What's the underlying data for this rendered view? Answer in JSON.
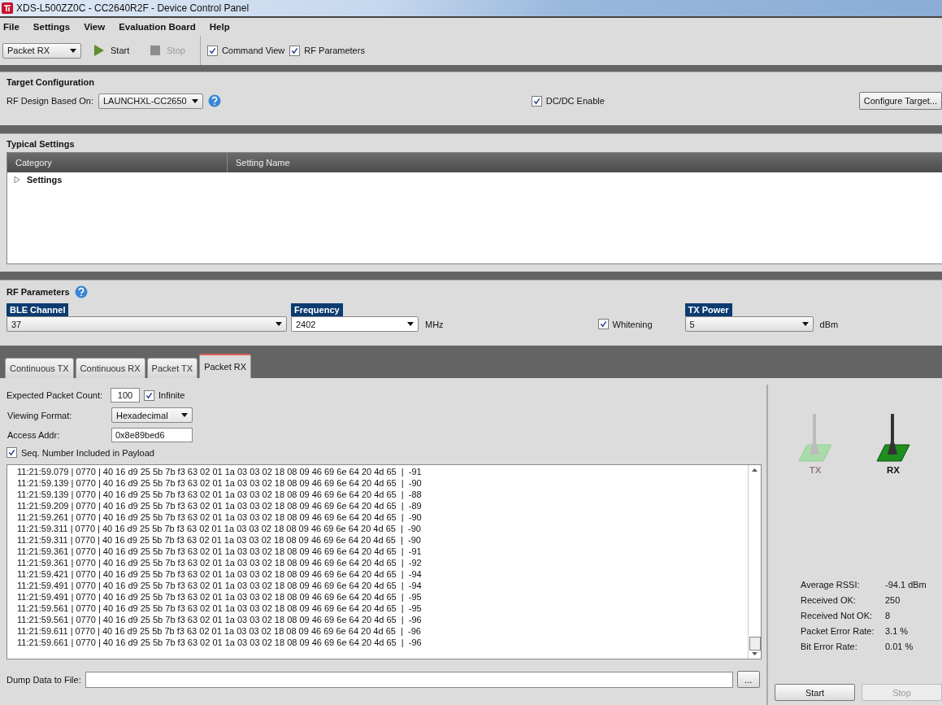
{
  "window": {
    "title": "XDS-L500ZZ0C - CC2640R2F - Device Control Panel"
  },
  "menu": [
    "File",
    "Settings",
    "View",
    "Evaluation Board",
    "Help"
  ],
  "toolbar": {
    "mode": "Packet RX",
    "start": {
      "label": "Start",
      "disabled": false
    },
    "stop": {
      "label": "Stop",
      "disabled": true
    },
    "checks": [
      {
        "label": "Command View",
        "checked": true
      },
      {
        "label": "RF Parameters",
        "checked": true
      }
    ]
  },
  "target": {
    "title": "Target Configuration",
    "design_label": "RF Design Based On:",
    "design": "LAUNCHXL-CC2650",
    "dcdc": {
      "label": "DC/DC Enable",
      "checked": true
    },
    "configure": "Configure Target..."
  },
  "typical": {
    "title": "Typical Settings",
    "columns": [
      "Category",
      "Setting Name"
    ],
    "rows": [
      {
        "label": "Settings",
        "expanded": false
      }
    ]
  },
  "rf": {
    "title": "RF Parameters",
    "channel": {
      "label": "BLE Channel",
      "value": "37"
    },
    "frequency": {
      "label": "Frequency",
      "value": "2402",
      "unit": "MHz"
    },
    "whitening": {
      "label": "Whitening",
      "checked": true
    },
    "power": {
      "label": "TX Power",
      "value": "5",
      "unit": "dBm"
    }
  },
  "tabs": [
    {
      "label": "Continuous TX",
      "selected": false
    },
    {
      "label": "Continuous RX",
      "selected": false
    },
    {
      "label": "Packet TX",
      "selected": false
    },
    {
      "label": "Packet RX",
      "selected": true
    }
  ],
  "packet_rx": {
    "count_label": "Expected Packet Count:",
    "count": "100",
    "infinite": {
      "label": "Infinite",
      "checked": true
    },
    "format_label": "Viewing Format:",
    "format": "Hexadecimal",
    "addr_label": "Access Addr:",
    "addr": "0x8e89bed6",
    "seq": {
      "label": "Seq. Number Included in Payload",
      "checked": true
    },
    "log": [
      "11:21:59.079 | 0770 | 40 16 d9 25 5b 7b f3 63 02 01 1a 03 03 02 18 08 09 46 69 6e 64 20 4d 65  |  -91",
      "11:21:59.139 | 0770 | 40 16 d9 25 5b 7b f3 63 02 01 1a 03 03 02 18 08 09 46 69 6e 64 20 4d 65  |  -90",
      "11:21:59.139 | 0770 | 40 16 d9 25 5b 7b f3 63 02 01 1a 03 03 02 18 08 09 46 69 6e 64 20 4d 65  |  -88",
      "11:21:59.209 | 0770 | 40 16 d9 25 5b 7b f3 63 02 01 1a 03 03 02 18 08 09 46 69 6e 64 20 4d 65  |  -89",
      "11:21:59.261 | 0770 | 40 16 d9 25 5b 7b f3 63 02 01 1a 03 03 02 18 08 09 46 69 6e 64 20 4d 65  |  -90",
      "11:21:59.311 | 0770 | 40 16 d9 25 5b 7b f3 63 02 01 1a 03 03 02 18 08 09 46 69 6e 64 20 4d 65  |  -90",
      "11:21:59.311 | 0770 | 40 16 d9 25 5b 7b f3 63 02 01 1a 03 03 02 18 08 09 46 69 6e 64 20 4d 65  |  -90",
      "11:21:59.361 | 0770 | 40 16 d9 25 5b 7b f3 63 02 01 1a 03 03 02 18 08 09 46 69 6e 64 20 4d 65  |  -91",
      "11:21:59.361 | 0770 | 40 16 d9 25 5b 7b f3 63 02 01 1a 03 03 02 18 08 09 46 69 6e 64 20 4d 65  |  -92",
      "11:21:59.421 | 0770 | 40 16 d9 25 5b 7b f3 63 02 01 1a 03 03 02 18 08 09 46 69 6e 64 20 4d 65  |  -94",
      "11:21:59.491 | 0770 | 40 16 d9 25 5b 7b f3 63 02 01 1a 03 03 02 18 08 09 46 69 6e 64 20 4d 65  |  -94",
      "11:21:59.491 | 0770 | 40 16 d9 25 5b 7b f3 63 02 01 1a 03 03 02 18 08 09 46 69 6e 64 20 4d 65  |  -95",
      "11:21:59.561 | 0770 | 40 16 d9 25 5b 7b f3 63 02 01 1a 03 03 02 18 08 09 46 69 6e 64 20 4d 65  |  -95",
      "11:21:59.561 | 0770 | 40 16 d9 25 5b 7b f3 63 02 01 1a 03 03 02 18 08 09 46 69 6e 64 20 4d 65  |  -96",
      "11:21:59.611 | 0770 | 40 16 d9 25 5b 7b f3 63 02 01 1a 03 03 02 18 08 09 46 69 6e 64 20 4d 65  |  -96",
      "11:21:59.661 | 0770 | 40 16 d9 25 5b 7b f3 63 02 01 1a 03 03 02 18 08 09 46 69 6e 64 20 4d 65  |  -96"
    ],
    "dump_label": "Dump Data to File:",
    "browse": "...",
    "indicators": [
      {
        "label": "TX",
        "active": false
      },
      {
        "label": "RX",
        "active": true
      }
    ],
    "stats": [
      {
        "label": "Average RSSI:",
        "value": "-94.1 dBm"
      },
      {
        "label": "Received OK:",
        "value": "250"
      },
      {
        "label": "Received Not OK:",
        "value": "8"
      },
      {
        "label": "Packet Error Rate:",
        "value": "3.1 %"
      },
      {
        "label": "Bit Error Rate:",
        "value": "0.01 %"
      }
    ],
    "start": {
      "label": "Start",
      "disabled": false
    },
    "stop": {
      "label": "Stop",
      "disabled": true
    }
  }
}
